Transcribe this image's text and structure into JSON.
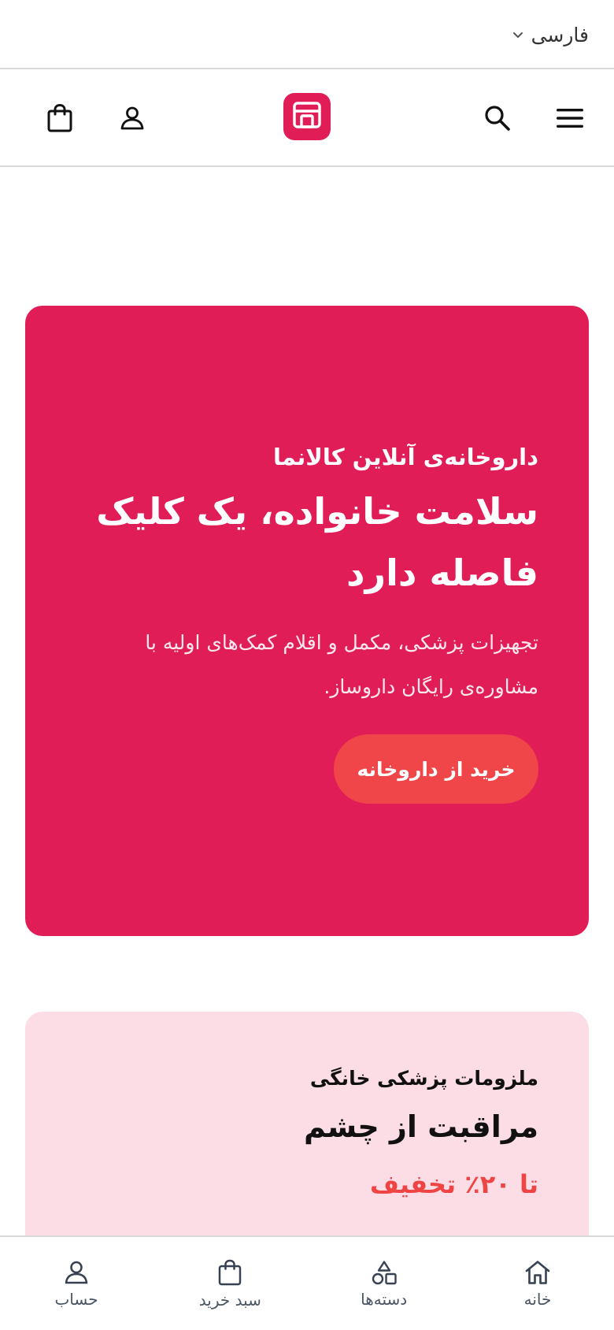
{
  "language": {
    "label": "فارسی"
  },
  "hero": {
    "eyebrow": "داروخانه‌ی آنلاین کالانما",
    "title": "سلامت خانواده، یک کلیک فاصله دارد",
    "description": "تجهیزات پزشکی، مکمل و اقلام کمک‌های اولیه با مشاوره‌ی رایگان داروساز.",
    "cta_label": "خرید از داروخانه"
  },
  "promo": {
    "eyebrow": "ملزومات پزشکی خانگی",
    "title": "مراقبت از چشم",
    "discount": "تا ۲۰٪ تخفیف"
  },
  "bottom_nav": {
    "items": [
      {
        "label": "خانه",
        "icon": "home-icon"
      },
      {
        "label": "دسته‌ها",
        "icon": "categories-icon"
      },
      {
        "label": "سبد خرید",
        "icon": "cart-icon"
      },
      {
        "label": "حساب",
        "icon": "user-icon"
      }
    ]
  },
  "colors": {
    "brand": "#e11d58",
    "cta": "#f0464a",
    "promo_background": "#fcdde6",
    "discount": "#ef4444"
  }
}
